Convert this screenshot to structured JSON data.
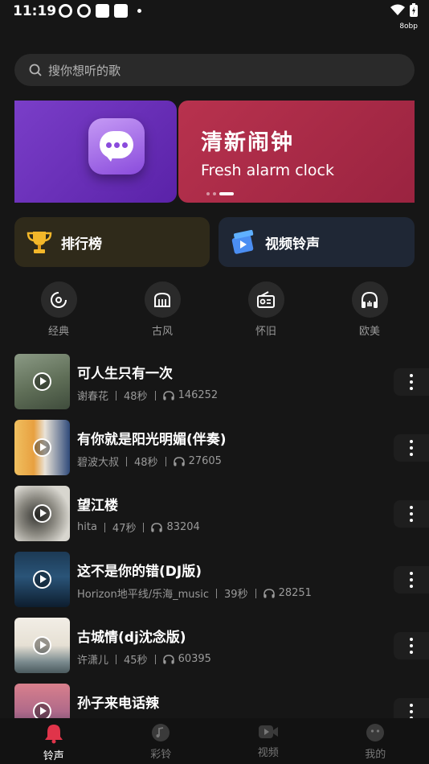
{
  "status_bar": {
    "time": "11:19",
    "net_speed": "8obp"
  },
  "search": {
    "placeholder": "搜你想听的歌"
  },
  "banner": {
    "title_cn": "清新闹钟",
    "title_en": "Fresh alarm clock"
  },
  "quick_links": [
    {
      "label": "排行榜",
      "icon": "trophy-icon"
    },
    {
      "label": "视频铃声",
      "icon": "video-clapper-icon"
    }
  ],
  "categories": [
    {
      "label": "经典",
      "icon": "vinyl-record-icon"
    },
    {
      "label": "古风",
      "icon": "guzheng-icon"
    },
    {
      "label": "怀旧",
      "icon": "radio-icon"
    },
    {
      "label": "欧美",
      "icon": "headphones-icon"
    }
  ],
  "songs": [
    {
      "title": "可人生只有一次",
      "artist": "谢春花",
      "duration": "48秒",
      "plays": "146252",
      "thumb_colors": [
        "#6f7f6a",
        "#3f4c3c"
      ]
    },
    {
      "title": "有你就是阳光明媚(伴奏)",
      "artist": "碧波大叔",
      "duration": "48秒",
      "plays": "27605",
      "thumb_colors": [
        "#e8b048",
        "#2f4a7a"
      ]
    },
    {
      "title": "望江楼",
      "artist": "hita",
      "duration": "47秒",
      "plays": "83204",
      "thumb_colors": [
        "#d8d6cf",
        "#3a3a36"
      ]
    },
    {
      "title": "这不是你的错(DJ版)",
      "artist": "Horizon地平线/乐海_music",
      "duration": "39秒",
      "plays": "28251",
      "thumb_colors": [
        "#1c3a55",
        "#0d1d2e"
      ]
    },
    {
      "title": "古城情(dj沈念版)",
      "artist": "许潇儿",
      "duration": "45秒",
      "plays": "60395",
      "thumb_colors": [
        "#f0ece4",
        "#7a8a8e"
      ]
    },
    {
      "title": "孙子来电话辣",
      "artist": "",
      "duration": "",
      "plays": "",
      "thumb_colors": [
        "#d9808c",
        "#4a3a60"
      ]
    }
  ],
  "nav": [
    {
      "label": "铃声",
      "icon": "bell-icon",
      "active": true
    },
    {
      "label": "彩铃",
      "icon": "music-note-icon",
      "active": false
    },
    {
      "label": "视频",
      "icon": "video-play-icon",
      "active": false
    },
    {
      "label": "我的",
      "icon": "smiley-face-icon",
      "active": false
    }
  ],
  "colors": {
    "background": "#161616",
    "accent_red": "#e0344a",
    "banner_red": "#b8324e",
    "banner_purple": "#7a3ec8"
  }
}
